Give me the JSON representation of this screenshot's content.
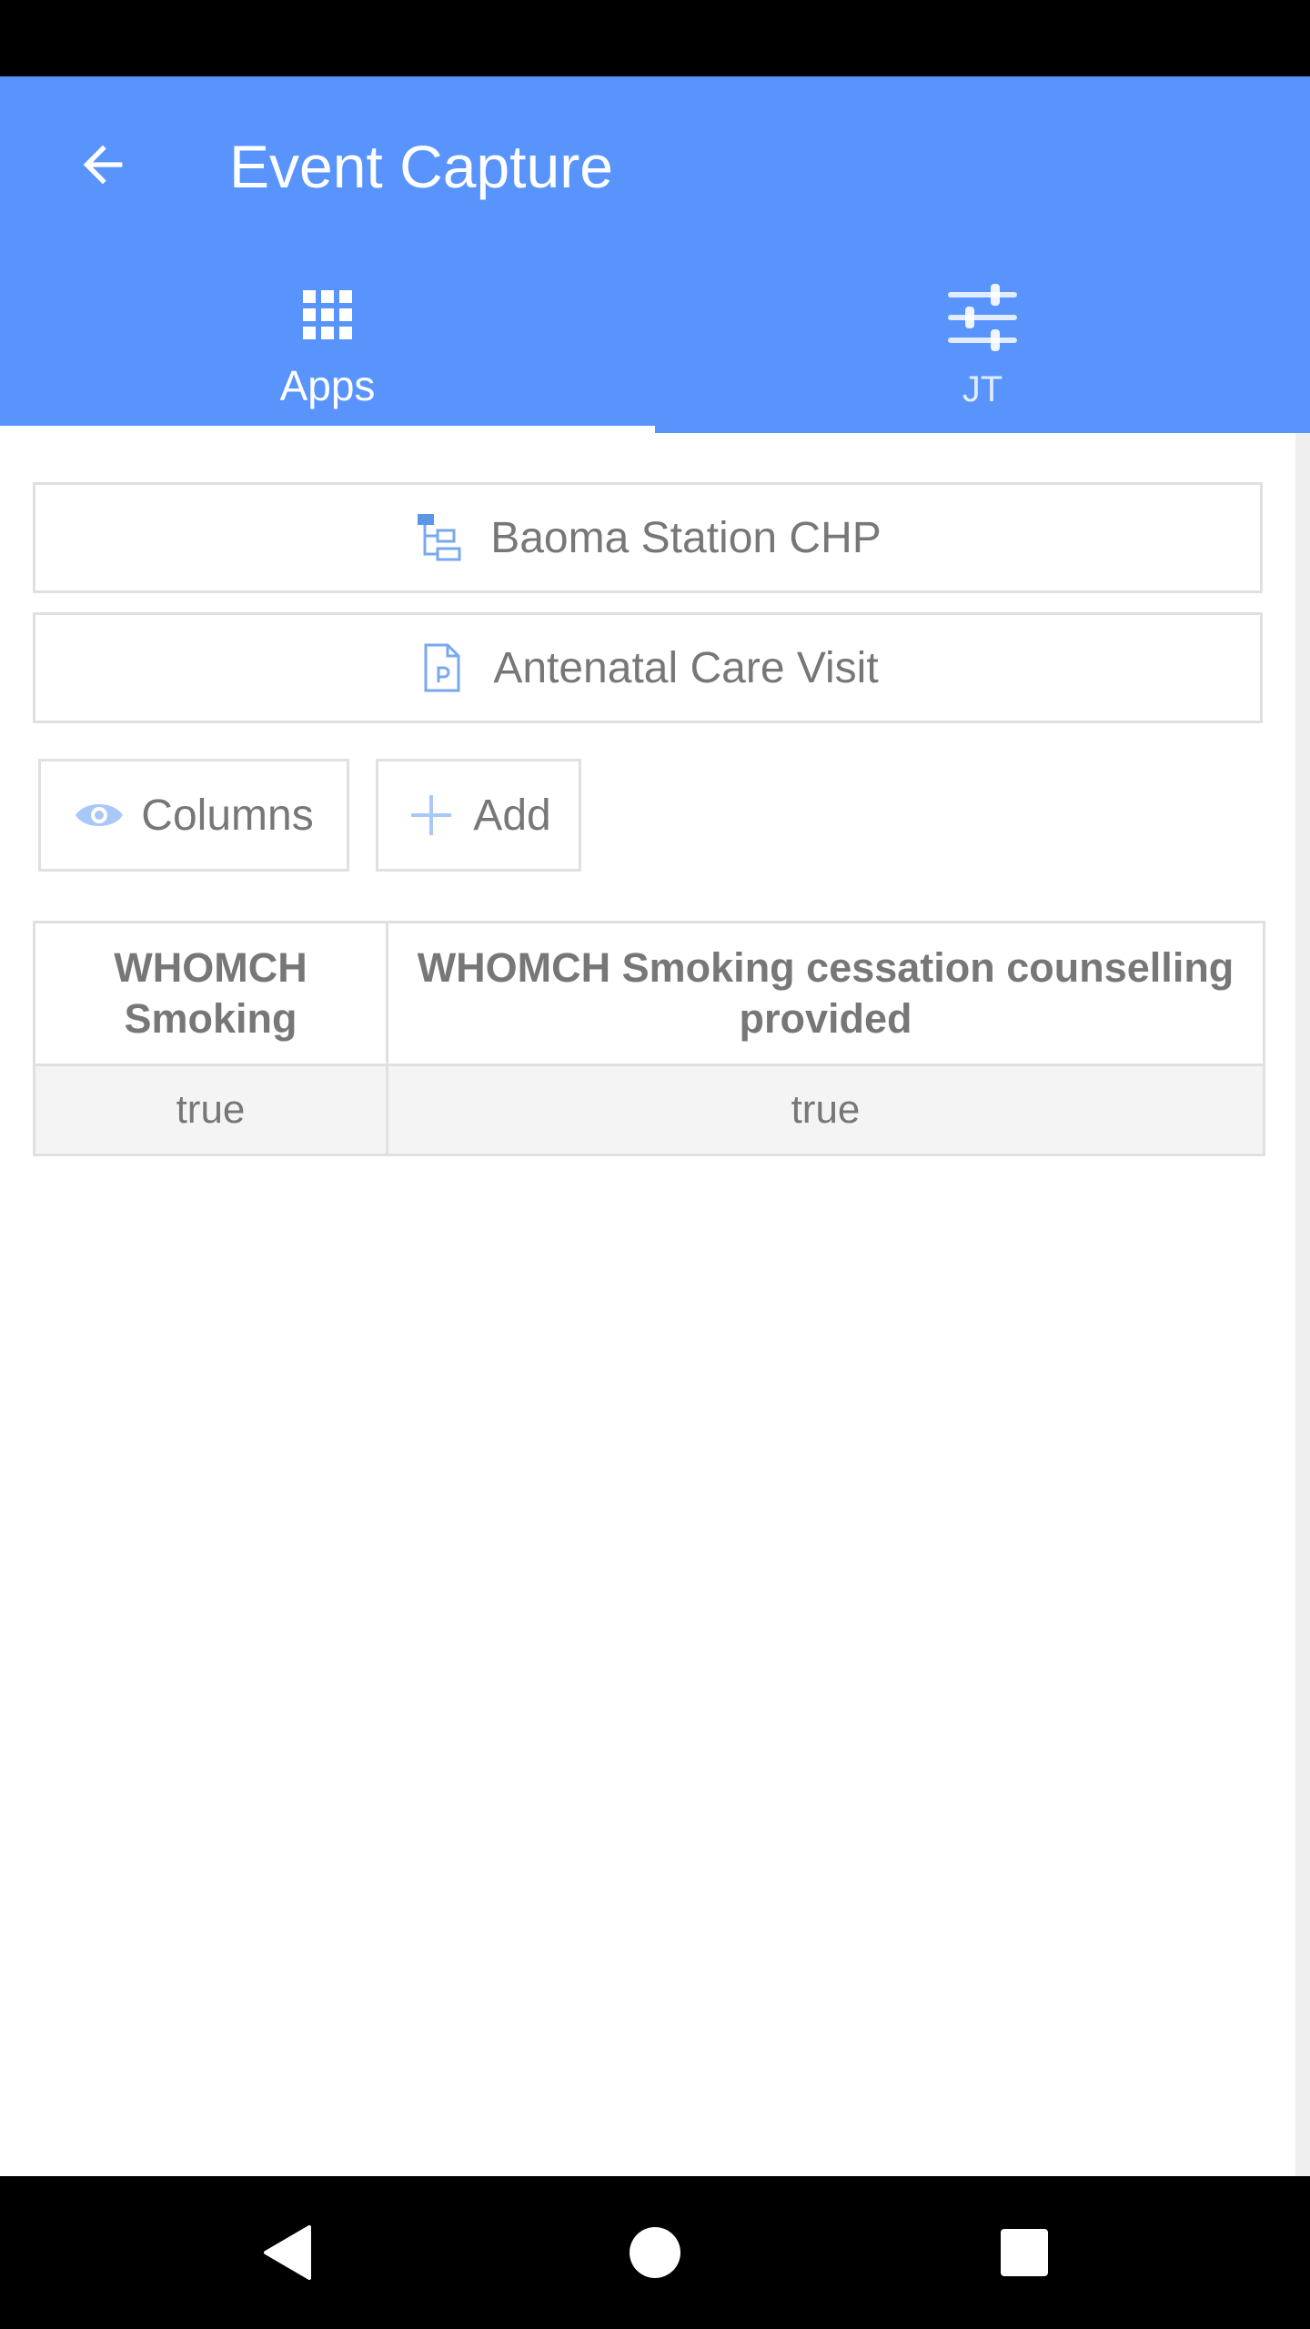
{
  "header": {
    "title": "Event Capture",
    "back_icon": "arrow-left-icon"
  },
  "tabs": [
    {
      "label": "Apps",
      "icon": "apps-grid-icon",
      "selected": true
    },
    {
      "label": "JT",
      "icon": "sliders-icon",
      "selected": false
    }
  ],
  "selectors": {
    "org_unit": {
      "label": "Baoma Station CHP",
      "icon": "org-tree-icon"
    },
    "program": {
      "label": "Antenatal Care Visit",
      "icon": "document-icon"
    }
  },
  "toolbar": {
    "columns_label": "Columns",
    "add_label": "Add"
  },
  "table": {
    "columns": [
      "WHOMCH Smoking",
      "WHOMCH Smoking cessation counselling provided"
    ],
    "rows": [
      [
        "true",
        "true"
      ]
    ]
  },
  "colors": {
    "primary": "#5994fc",
    "border": "#e0e0e0",
    "text_muted": "#777777",
    "icon_accent": "#a8c8f8"
  }
}
